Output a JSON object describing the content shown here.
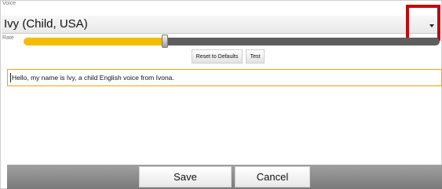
{
  "voice": {
    "caption": "Voice",
    "selected": "Ivy (Child, USA)"
  },
  "rate": {
    "caption": "Rate",
    "level_fraction": 0.34
  },
  "buttons": {
    "reset": "Reset to Defaults",
    "test": "Test"
  },
  "text_field": {
    "value": "Hello, my name is Ivy, a child English voice from Ivona."
  },
  "footer": {
    "save": "Save",
    "cancel": "Cancel"
  },
  "colors": {
    "accent": "#f4bb00",
    "highlight": "#c0090f",
    "field_border": "#f0a500"
  },
  "icons": {
    "dropdown": "chevron-down-icon"
  }
}
